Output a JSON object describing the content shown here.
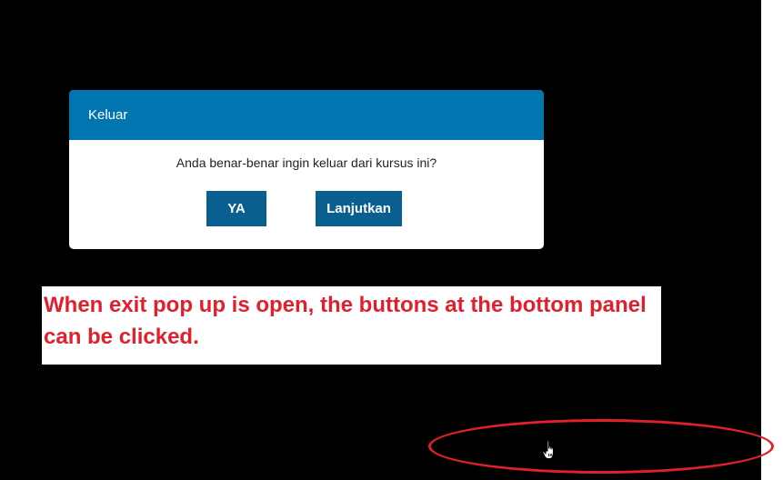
{
  "dialog": {
    "title": "Keluar",
    "message": "Anda benar-benar ingin keluar dari kursus ini?",
    "yes_label": "YA",
    "continue_label": "Lanjutkan"
  },
  "annotation": {
    "text": "When exit pop up is open, the buttons at the bottom panel can be clicked."
  },
  "colors": {
    "header": "#0075b0",
    "button": "#0a5f91",
    "annotation": "#e0202a",
    "backdrop": "#000000"
  },
  "icons": {
    "cursor": "hand-pointer-icon"
  }
}
